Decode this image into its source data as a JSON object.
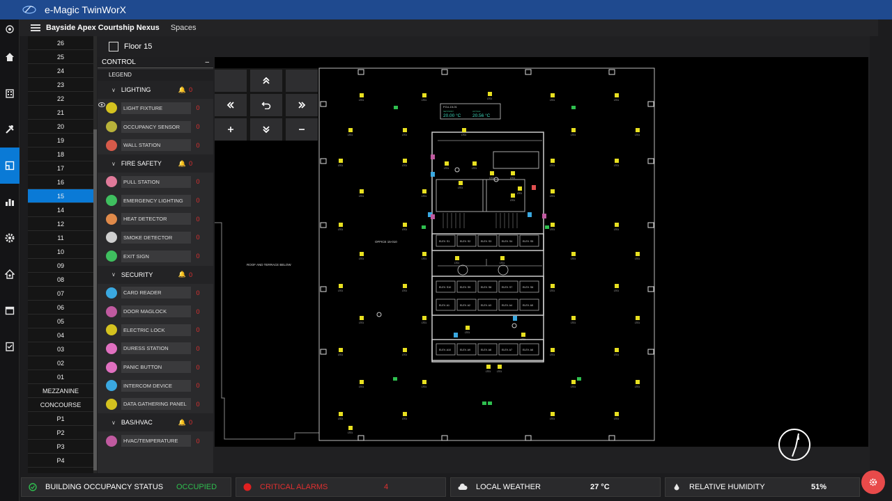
{
  "app": {
    "title": "e-Magic TwinWorX"
  },
  "appbar": {
    "building": "Bayside Apex Courtship Nexus",
    "spaces": "Spaces"
  },
  "floor": {
    "name": "Floor 15"
  },
  "floors": [
    "26",
    "25",
    "24",
    "23",
    "22",
    "21",
    "20",
    "19",
    "18",
    "17",
    "16",
    "15",
    "14",
    "12",
    "11",
    "10",
    "09",
    "08",
    "07",
    "06",
    "05",
    "04",
    "03",
    "02",
    "01",
    "MEZZANINE",
    "CONCOURSE",
    "P1",
    "P2",
    "P3",
    "P4"
  ],
  "selected_floor": "15",
  "control": {
    "title": "CONTROL",
    "collapse": "–",
    "legend": "LEGEND",
    "categories": [
      {
        "label": "LIGHTING",
        "count": "0",
        "items": [
          {
            "label": "LIGHT FIXTURE",
            "count": "0",
            "icon": "bulb-icon",
            "color": "#d4c21f"
          },
          {
            "label": "OCCUPANCY SENSOR",
            "count": "0",
            "icon": "occupancy-icon",
            "color": "#b8b23a"
          },
          {
            "label": "WALL STATION",
            "count": "0",
            "icon": "wall-station-icon",
            "color": "#d65a4a"
          }
        ]
      },
      {
        "label": "FIRE SAFETY",
        "count": "0",
        "items": [
          {
            "label": "PULL STATION",
            "count": "0",
            "icon": "pull-station-icon",
            "color": "#e07a9a"
          },
          {
            "label": "EMERGENCY LIGHTING",
            "count": "0",
            "icon": "emergency-light-icon",
            "color": "#3fbf5f"
          },
          {
            "label": "HEAT DETECTOR",
            "count": "0",
            "icon": "heat-detector-icon",
            "color": "#e08a4a"
          },
          {
            "label": "SMOKE DETECTOR",
            "count": "0",
            "icon": "smoke-detector-icon",
            "color": "#cfcfcf"
          },
          {
            "label": "EXIT SIGN",
            "count": "0",
            "icon": "exit-sign-icon",
            "color": "#3fbf5f"
          }
        ]
      },
      {
        "label": "SECURITY",
        "count": "0",
        "items": [
          {
            "label": "CARD READER",
            "count": "0",
            "icon": "card-reader-icon",
            "color": "#3aa8e0"
          },
          {
            "label": "DOOR MAGLOCK",
            "count": "0",
            "icon": "maglock-icon",
            "color": "#c05aa0"
          },
          {
            "label": "ELECTRIC LOCK",
            "count": "0",
            "icon": "electric-lock-icon",
            "color": "#d4c21f"
          },
          {
            "label": "DURESS STATION",
            "count": "0",
            "icon": "duress-icon",
            "color": "#e070c0"
          },
          {
            "label": "PANIC BUTTON",
            "count": "0",
            "icon": "panic-icon",
            "color": "#e070c0"
          },
          {
            "label": "INTERCOM DEVICE",
            "count": "0",
            "icon": "intercom-icon",
            "color": "#3aa8e0"
          },
          {
            "label": "DATA GATHERING PANEL",
            "count": "0",
            "icon": "dgp-icon",
            "color": "#d4c21f"
          }
        ]
      },
      {
        "label": "BAS/HVAC",
        "count": "0",
        "items": [
          {
            "label": "HVAC/TEMPERATURE",
            "count": "0",
            "icon": "hvac-icon",
            "color": "#c05aa0"
          }
        ]
      }
    ]
  },
  "plan": {
    "thermostat": {
      "label": "FCU-15-01",
      "setpoint_label": "SETPOINT",
      "setpoint": "20.00 °C",
      "actual_label": "ACTUAL",
      "actual": "20.56 °C"
    },
    "office_label": "OFFICE 15-010",
    "terrace_label": "ROOF AND TERRACE BELOW",
    "fixture_label": "LT01",
    "elevators_top": [
      "ELEV. S1",
      "ELEV. S2",
      "ELEV. S3",
      "ELEV. S4",
      "ELEV. S5"
    ],
    "elevators_mid": [
      "ELEV. S10",
      "ELEV. S9",
      "ELEV. S8",
      "ELEV. S7",
      "ELEV. S6"
    ],
    "elevators_a": [
      "ELEV. A1",
      "ELEV. A2",
      "ELEV. A3",
      "ELEV. A4",
      "ELEV. A5"
    ],
    "elevators_b": [
      "ELEV. A10",
      "ELEV. A9",
      "ELEV. A8",
      "ELEV. A7",
      "ELEV. A6"
    ]
  },
  "status": {
    "occupancy_label": "BUILDING OCCUPANCY STATUS",
    "occupancy_value": "OCCUPIED",
    "alarms_label": "CRITICAL ALARMS",
    "alarms_value": "4",
    "weather_label": "LOCAL WEATHER",
    "weather_value": "27 °C",
    "humidity_label": "RELATIVE HUMIDITY",
    "humidity_value": "51%"
  },
  "colors": {
    "accent": "#0a7ad6",
    "alarm": "#e03030",
    "occupied": "#2fbf4f",
    "fixture": "#e8e020",
    "topbar": "#1f4a8f"
  }
}
